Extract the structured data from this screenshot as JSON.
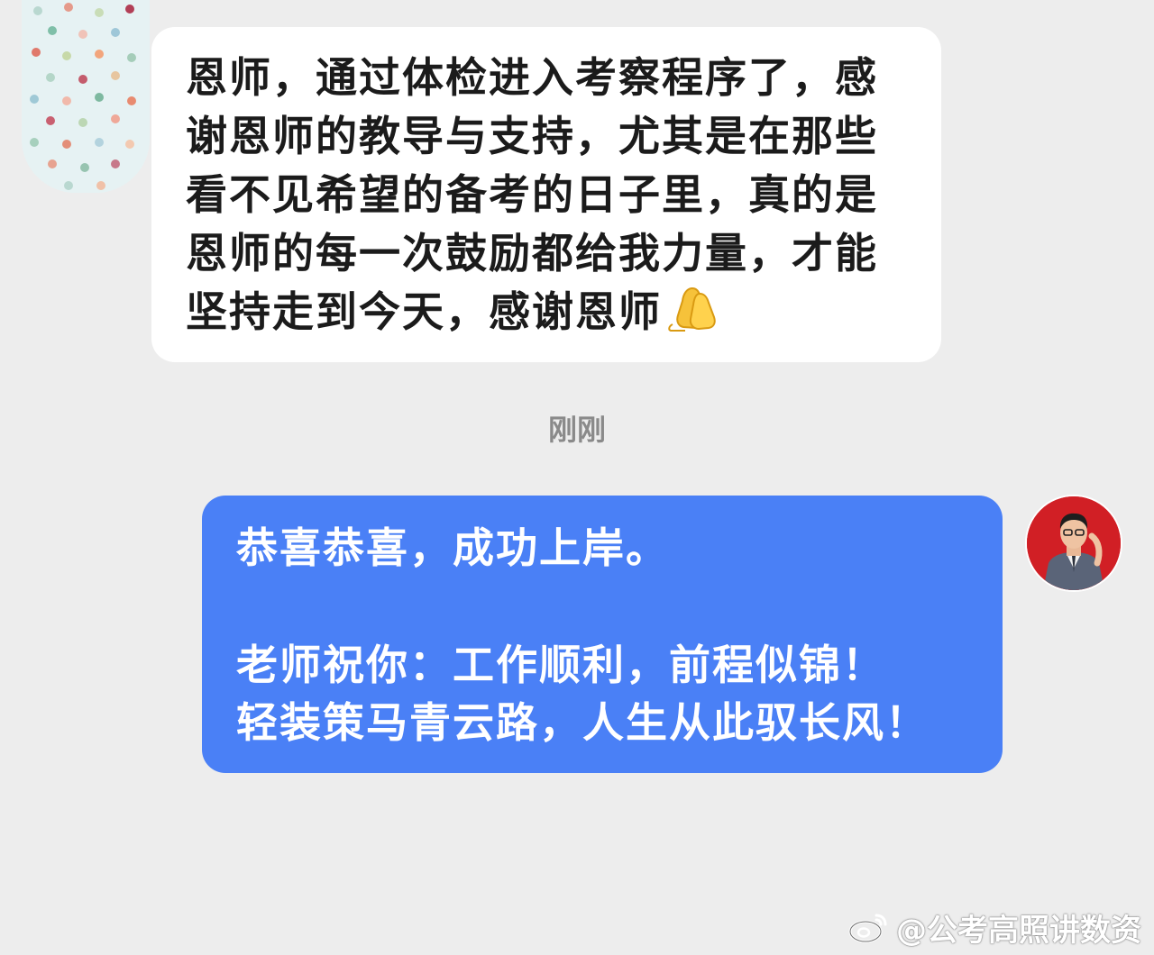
{
  "incoming_message": {
    "lines": [
      "恩师，通过体检进入考察程序了，感",
      "谢恩师的教导与支持，尤其是在那些",
      "看不见希望的备考的日子里，真的是",
      "恩师的每一次鼓励都给我力量，才能",
      "坚持走到今天，感谢恩师"
    ],
    "emoji": "folded-hands-icon"
  },
  "timestamp": "刚刚",
  "outgoing_message": {
    "line1": "恭喜恭喜，成功上岸。",
    "line2": "老师祝你：工作顺利，前程似锦！",
    "line3": "轻装策马青云路，人生从此驭长风！"
  },
  "watermark": {
    "text": "@公考高照讲数资",
    "icon": "weibo-icon"
  },
  "colors": {
    "background": "#ededed",
    "incoming_bubble": "#ffffff",
    "outgoing_bubble": "#4a80f6",
    "timestamp": "#8a8a8a",
    "teacher_avatar_bg": "#d11f25"
  }
}
